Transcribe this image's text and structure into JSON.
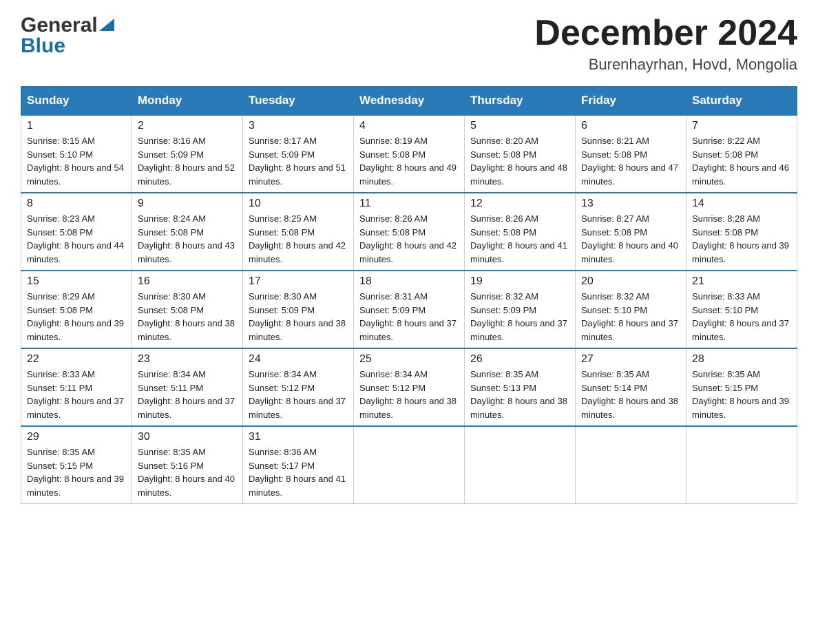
{
  "header": {
    "logo_general": "General",
    "logo_blue": "Blue",
    "month_title": "December 2024",
    "location": "Burenhayrhan, Hovd, Mongolia"
  },
  "columns": [
    "Sunday",
    "Monday",
    "Tuesday",
    "Wednesday",
    "Thursday",
    "Friday",
    "Saturday"
  ],
  "weeks": [
    [
      {
        "day": "1",
        "sunrise": "8:15 AM",
        "sunset": "5:10 PM",
        "daylight": "8 hours and 54 minutes."
      },
      {
        "day": "2",
        "sunrise": "8:16 AM",
        "sunset": "5:09 PM",
        "daylight": "8 hours and 52 minutes."
      },
      {
        "day": "3",
        "sunrise": "8:17 AM",
        "sunset": "5:09 PM",
        "daylight": "8 hours and 51 minutes."
      },
      {
        "day": "4",
        "sunrise": "8:19 AM",
        "sunset": "5:08 PM",
        "daylight": "8 hours and 49 minutes."
      },
      {
        "day": "5",
        "sunrise": "8:20 AM",
        "sunset": "5:08 PM",
        "daylight": "8 hours and 48 minutes."
      },
      {
        "day": "6",
        "sunrise": "8:21 AM",
        "sunset": "5:08 PM",
        "daylight": "8 hours and 47 minutes."
      },
      {
        "day": "7",
        "sunrise": "8:22 AM",
        "sunset": "5:08 PM",
        "daylight": "8 hours and 46 minutes."
      }
    ],
    [
      {
        "day": "8",
        "sunrise": "8:23 AM",
        "sunset": "5:08 PM",
        "daylight": "8 hours and 44 minutes."
      },
      {
        "day": "9",
        "sunrise": "8:24 AM",
        "sunset": "5:08 PM",
        "daylight": "8 hours and 43 minutes."
      },
      {
        "day": "10",
        "sunrise": "8:25 AM",
        "sunset": "5:08 PM",
        "daylight": "8 hours and 42 minutes."
      },
      {
        "day": "11",
        "sunrise": "8:26 AM",
        "sunset": "5:08 PM",
        "daylight": "8 hours and 42 minutes."
      },
      {
        "day": "12",
        "sunrise": "8:26 AM",
        "sunset": "5:08 PM",
        "daylight": "8 hours and 41 minutes."
      },
      {
        "day": "13",
        "sunrise": "8:27 AM",
        "sunset": "5:08 PM",
        "daylight": "8 hours and 40 minutes."
      },
      {
        "day": "14",
        "sunrise": "8:28 AM",
        "sunset": "5:08 PM",
        "daylight": "8 hours and 39 minutes."
      }
    ],
    [
      {
        "day": "15",
        "sunrise": "8:29 AM",
        "sunset": "5:08 PM",
        "daylight": "8 hours and 39 minutes."
      },
      {
        "day": "16",
        "sunrise": "8:30 AM",
        "sunset": "5:08 PM",
        "daylight": "8 hours and 38 minutes."
      },
      {
        "day": "17",
        "sunrise": "8:30 AM",
        "sunset": "5:09 PM",
        "daylight": "8 hours and 38 minutes."
      },
      {
        "day": "18",
        "sunrise": "8:31 AM",
        "sunset": "5:09 PM",
        "daylight": "8 hours and 37 minutes."
      },
      {
        "day": "19",
        "sunrise": "8:32 AM",
        "sunset": "5:09 PM",
        "daylight": "8 hours and 37 minutes."
      },
      {
        "day": "20",
        "sunrise": "8:32 AM",
        "sunset": "5:10 PM",
        "daylight": "8 hours and 37 minutes."
      },
      {
        "day": "21",
        "sunrise": "8:33 AM",
        "sunset": "5:10 PM",
        "daylight": "8 hours and 37 minutes."
      }
    ],
    [
      {
        "day": "22",
        "sunrise": "8:33 AM",
        "sunset": "5:11 PM",
        "daylight": "8 hours and 37 minutes."
      },
      {
        "day": "23",
        "sunrise": "8:34 AM",
        "sunset": "5:11 PM",
        "daylight": "8 hours and 37 minutes."
      },
      {
        "day": "24",
        "sunrise": "8:34 AM",
        "sunset": "5:12 PM",
        "daylight": "8 hours and 37 minutes."
      },
      {
        "day": "25",
        "sunrise": "8:34 AM",
        "sunset": "5:12 PM",
        "daylight": "8 hours and 38 minutes."
      },
      {
        "day": "26",
        "sunrise": "8:35 AM",
        "sunset": "5:13 PM",
        "daylight": "8 hours and 38 minutes."
      },
      {
        "day": "27",
        "sunrise": "8:35 AM",
        "sunset": "5:14 PM",
        "daylight": "8 hours and 38 minutes."
      },
      {
        "day": "28",
        "sunrise": "8:35 AM",
        "sunset": "5:15 PM",
        "daylight": "8 hours and 39 minutes."
      }
    ],
    [
      {
        "day": "29",
        "sunrise": "8:35 AM",
        "sunset": "5:15 PM",
        "daylight": "8 hours and 39 minutes."
      },
      {
        "day": "30",
        "sunrise": "8:35 AM",
        "sunset": "5:16 PM",
        "daylight": "8 hours and 40 minutes."
      },
      {
        "day": "31",
        "sunrise": "8:36 AM",
        "sunset": "5:17 PM",
        "daylight": "8 hours and 41 minutes."
      },
      null,
      null,
      null,
      null
    ]
  ]
}
